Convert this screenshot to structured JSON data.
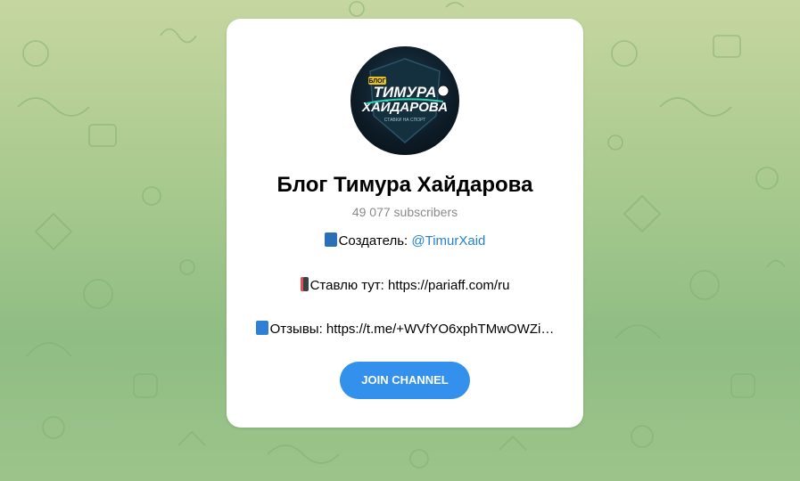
{
  "background": {
    "colors": [
      "#c6d6a0",
      "#8fbd84"
    ]
  },
  "channel": {
    "name": "Блог Тимура Хайдарова",
    "subscribers": "49 077 subscribers",
    "avatar": {
      "logo_top": "БЛОГ",
      "logo_line1": "ТИМУРА",
      "logo_line2": "ХАЙДАРОВА",
      "logo_tagline": "СТАВКИ НА СПОРТ"
    },
    "description": {
      "line1_prefix": "Создатель: ",
      "line1_link": "@TimurXaid",
      "line2": "Ставлю тут: https://pariaff.com/ru",
      "line3": "Отзывы: https://t.me/+WVfYO6xphTMwOWZi…"
    },
    "icons": {
      "line1": "top-badge-icon",
      "line2": "phone-icon",
      "line3": "book-icon"
    }
  },
  "actions": {
    "join_label": "JOIN CHANNEL"
  },
  "colors": {
    "accent": "#3390ec",
    "link": "#2481cc"
  }
}
